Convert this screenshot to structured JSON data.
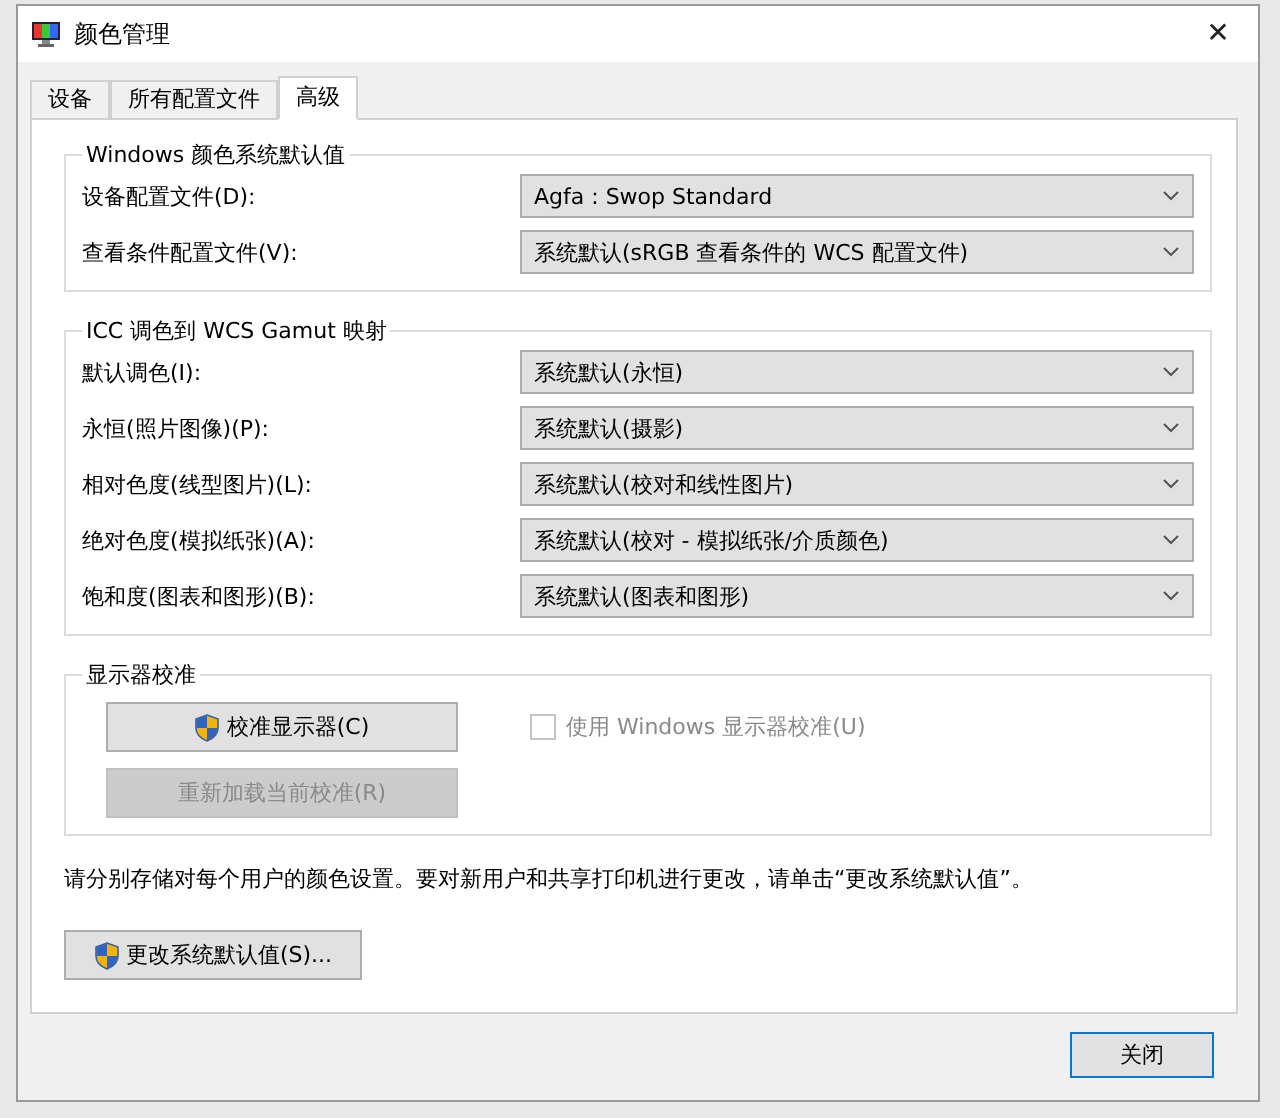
{
  "window": {
    "title": "颜色管理",
    "close": "✕"
  },
  "tabs": [
    {
      "label": "设备",
      "selected": false
    },
    {
      "label": "所有配置文件",
      "selected": false
    },
    {
      "label": "高级",
      "selected": true
    }
  ],
  "groups": [
    {
      "title": "Windows 颜色系统默认值",
      "rows": [
        {
          "label": "设备配置文件(D):",
          "value": "Agfa : Swop Standard"
        },
        {
          "label": "查看条件配置文件(V):",
          "value": "系统默认(sRGB 查看条件的 WCS 配置文件)"
        }
      ]
    },
    {
      "title": "ICC 调色到 WCS Gamut 映射",
      "rows": [
        {
          "label": "默认调色(I):",
          "value": "系统默认(永恒)"
        },
        {
          "label": "永恒(照片图像)(P):",
          "value": "系统默认(摄影)"
        },
        {
          "label": "相对色度(线型图片)(L):",
          "value": "系统默认(校对和线性图片)"
        },
        {
          "label": "绝对色度(模拟纸张)(A):",
          "value": "系统默认(校对 - 模拟纸张/介质颜色)"
        },
        {
          "label": "饱和度(图表和图形)(B):",
          "value": "系统默认(图表和图形)"
        }
      ]
    }
  ],
  "calibration": {
    "title": "显示器校准",
    "buttons": [
      {
        "label": "校准显示器(C)",
        "shield": true,
        "disabled": false
      },
      {
        "label": "重新加载当前校准(R)",
        "shield": false,
        "disabled": true
      }
    ],
    "checkbox": {
      "label": "使用 Windows 显示器校准(U)",
      "checked": false,
      "disabled": true
    }
  },
  "note": "请分别存储对每个用户的颜色设置。要对新用户和共享打印机进行更改，请单击“更改系统默认值”。",
  "defaults_button": {
    "label": "更改系统默认值(S)...",
    "shield": true
  },
  "close_button": {
    "label": "关闭"
  }
}
